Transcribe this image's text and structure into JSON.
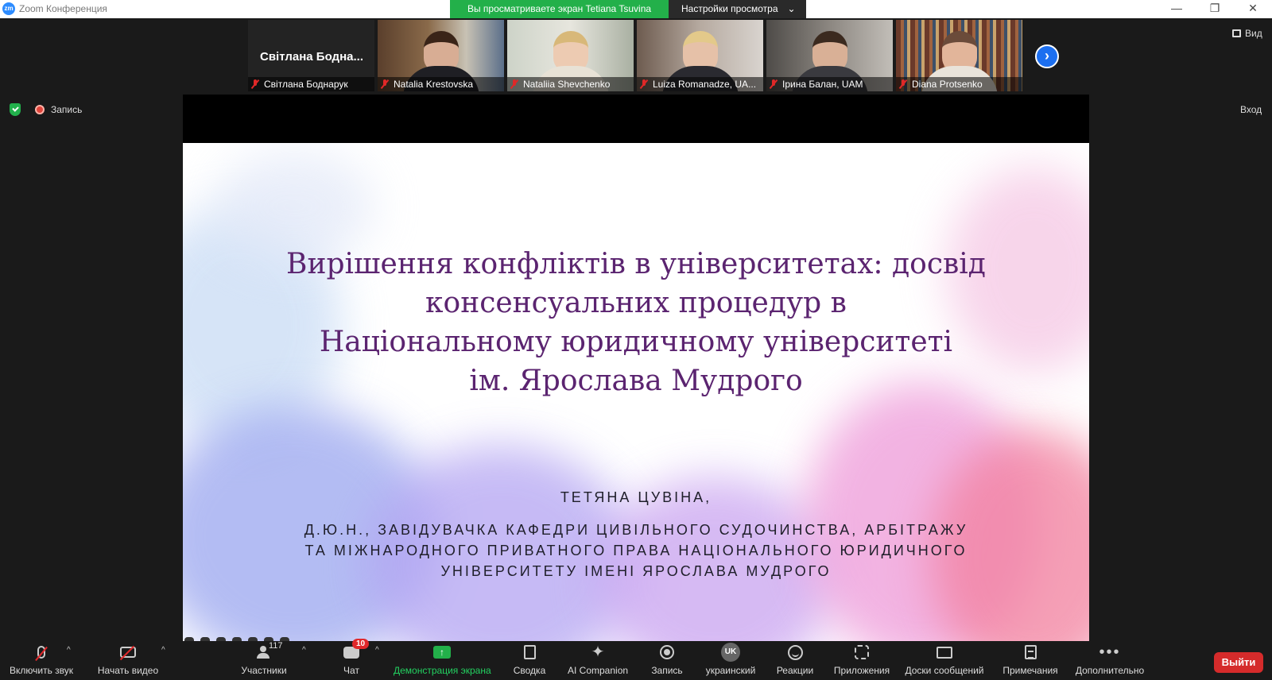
{
  "window": {
    "logo_text": "zm",
    "title": "Zoom Конференция",
    "viewing_banner": "Вы просматриваете экран Tetiana Tsuvina",
    "view_settings": "Настройки просмотра",
    "minimize": "—",
    "restore": "❐",
    "close": "✕"
  },
  "gallery": {
    "featured_name_full": "Світлана Боднарук",
    "featured_name_short": "Світлана Бодна...",
    "participants": [
      {
        "name": "Natalia Krestovska"
      },
      {
        "name": "Nataliia Shevchenko"
      },
      {
        "name": "Luiza Romanadze, UA..."
      },
      {
        "name": "Ірина Балан, UAM"
      },
      {
        "name": "Diana Protsenko"
      }
    ],
    "next_arrow": "›",
    "view_label": "Вид"
  },
  "status": {
    "recording_label": "Запись",
    "enter_label": "Вход"
  },
  "slide": {
    "title_lines": [
      "Вирішення конфліктів в університетах: досвід",
      "консенсуальних процедур в",
      "Національному юридичному університеті",
      "ім. Ярослава Мудрого"
    ],
    "author": "ТЕТЯНА ЦУВІНА,",
    "affiliation_lines": [
      "Д.Ю.Н., ЗАВІДУВАЧКА КАФЕДРИ ЦИВІЛЬНОГО СУДОЧИНСТВА, АРБІТРАЖУ",
      "ТА МІЖНАРОДНОГО ПРИВАТНОГО ПРАВА НАЦІОНАЛЬНОГО ЮРИДИЧНОГО",
      "УНІВЕРСИТЕТУ ІМЕНІ ЯРОСЛАВА МУДРОГО"
    ]
  },
  "toolbar": {
    "unmute": "Включить звук",
    "start_video": "Начать видео",
    "participants": "Участники",
    "participants_count": "117",
    "chat": "Чат",
    "chat_badge": "10",
    "share_screen": "Демонстрация экрана",
    "share_icon": "↑",
    "summary": "Сводка",
    "ai_companion": "AI Companion",
    "ai_icon": "✦",
    "record": "Запись",
    "language": "украинский",
    "language_code": "UK",
    "reactions": "Реакции",
    "apps": "Приложения",
    "whiteboards": "Доски сообщений",
    "notes": "Примечания",
    "more": "Дополнительно",
    "more_icon": "•••",
    "leave": "Выйти",
    "caret": "^"
  },
  "colors": {
    "slide_title": "#5b2470",
    "share_green": "#23b04a",
    "leave_red": "#d52b2b",
    "accent_blue": "#1c6ff0"
  }
}
